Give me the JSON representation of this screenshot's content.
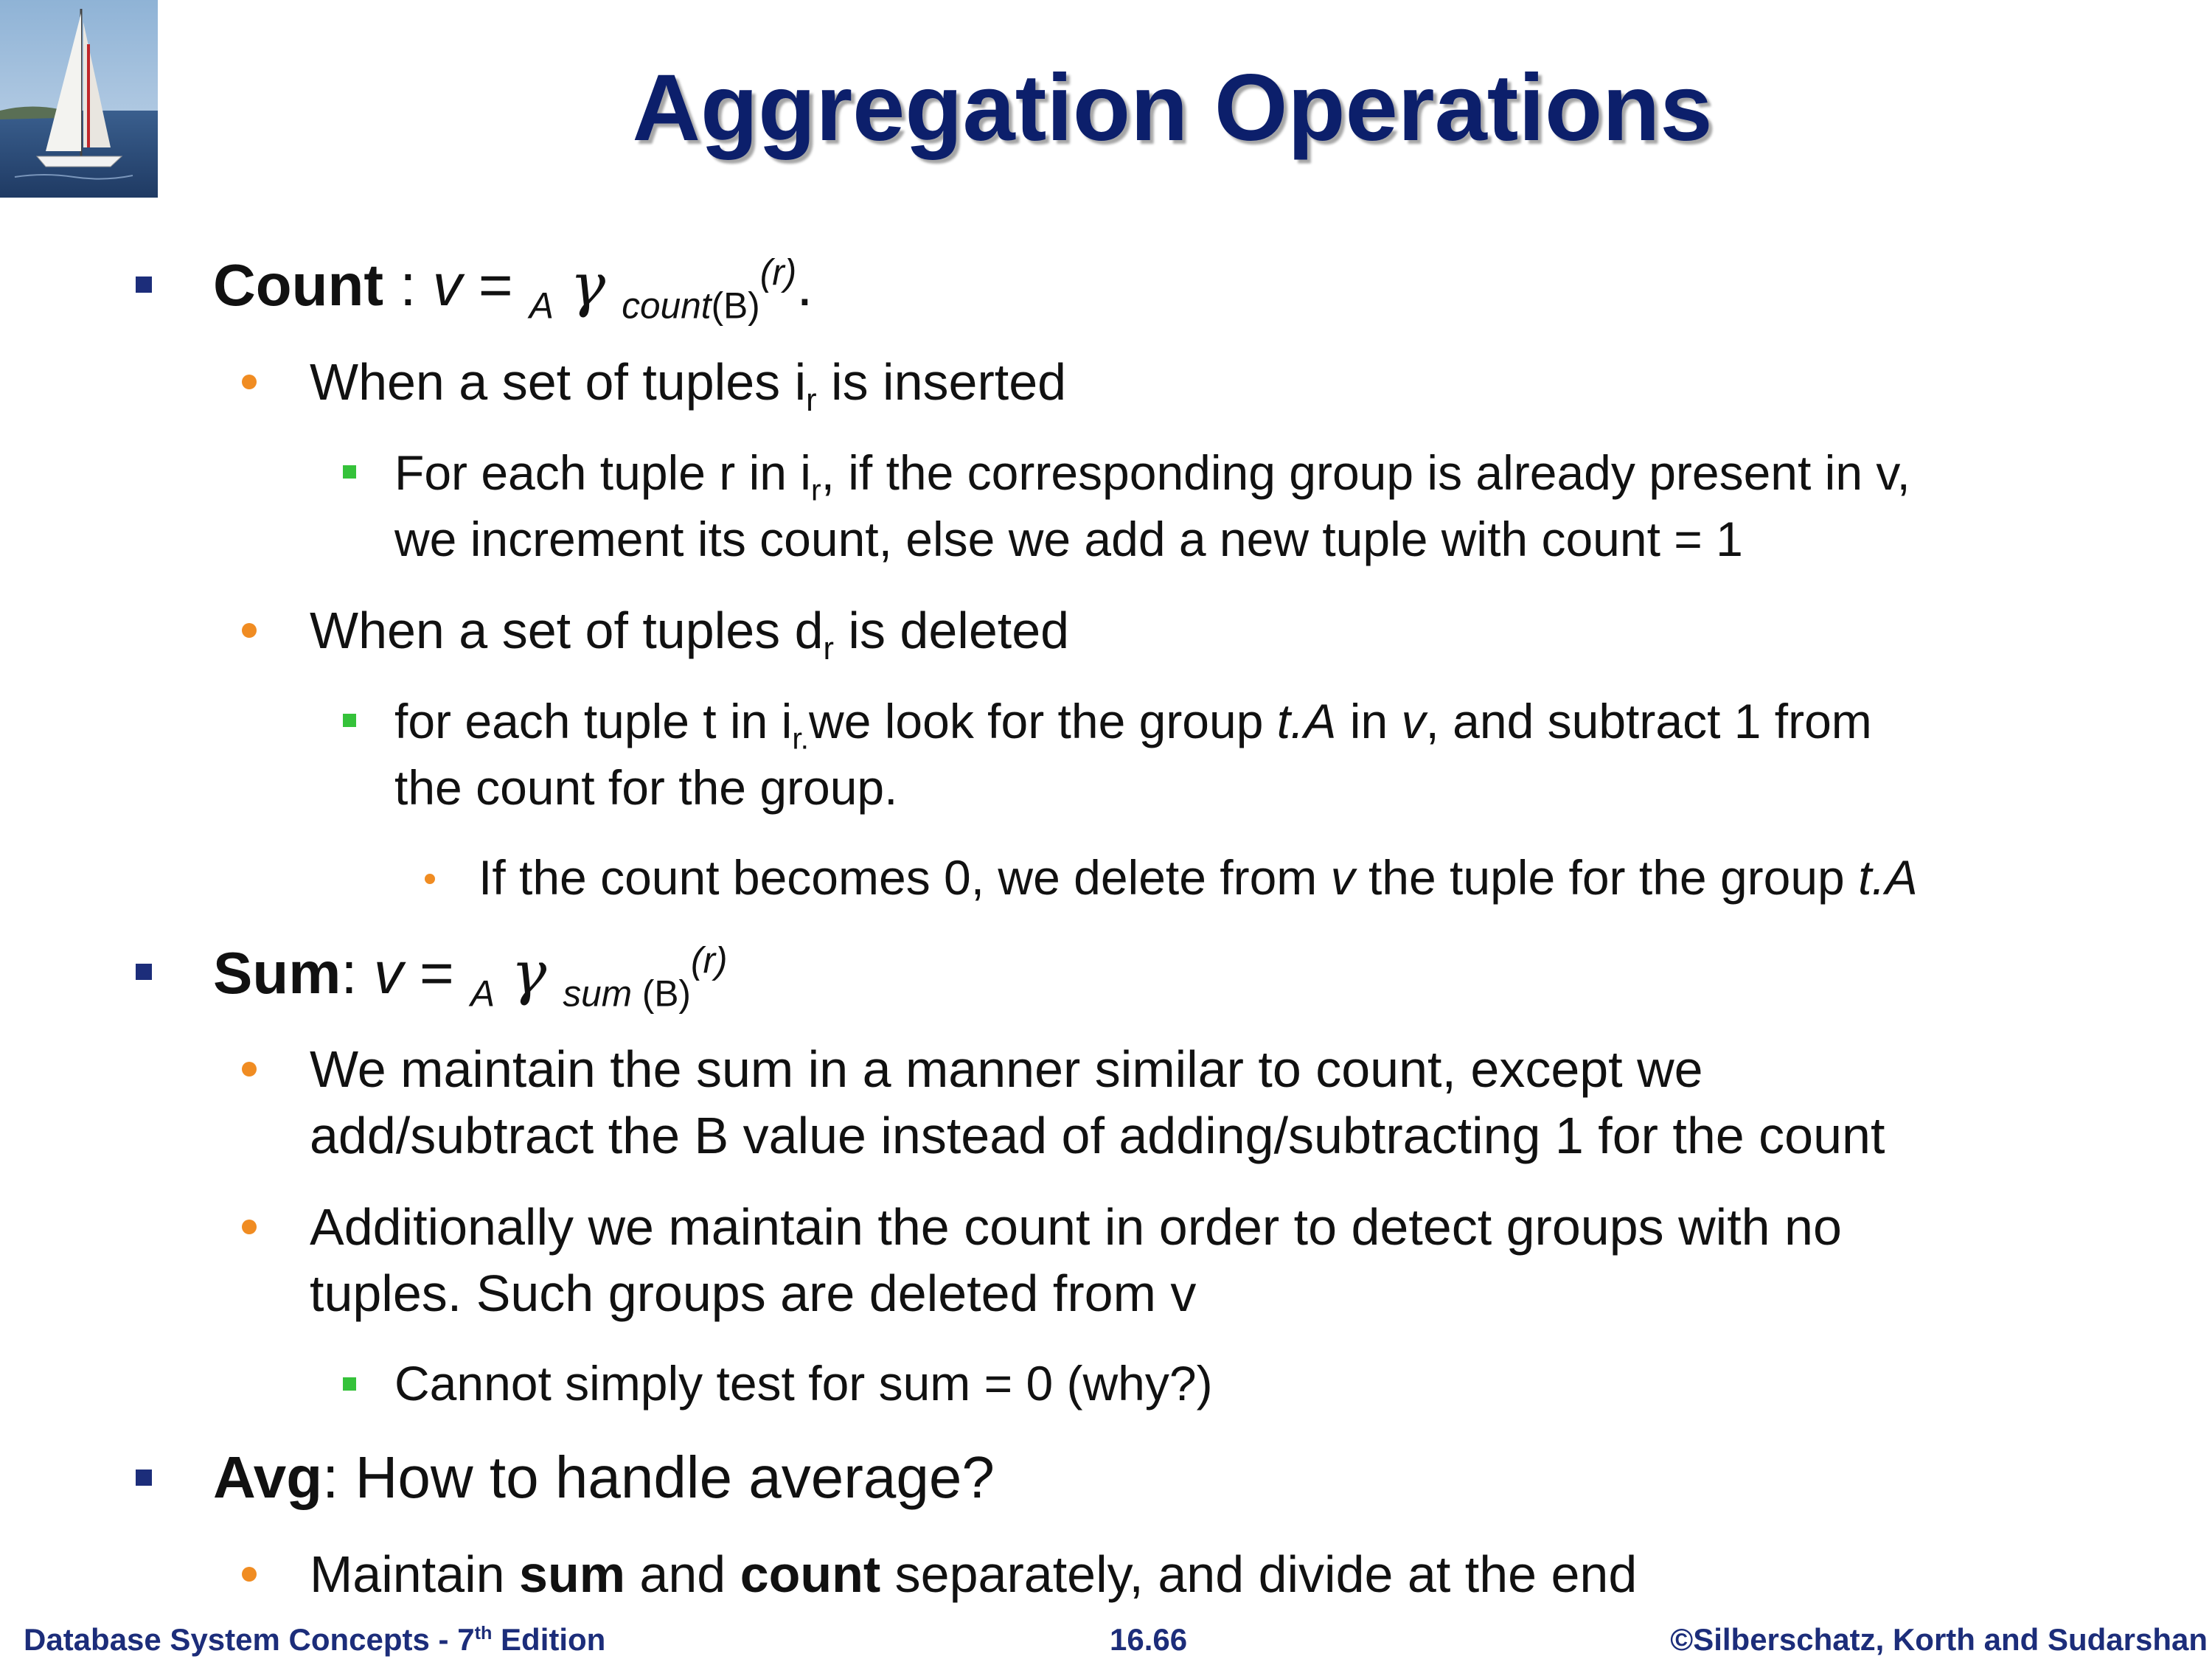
{
  "slide": {
    "title": "Aggregation Operations",
    "logo_description": "sailboat-image"
  },
  "count": {
    "label": "Count",
    "sep": " : ",
    "formula_v": "v",
    "formula_eq": " = ",
    "formula_group": "A",
    "formula_gamma": "γ",
    "formula_func": "count",
    "formula_arg": "(B)",
    "formula_rel": "(r)",
    "formula_end": ".",
    "insert": {
      "pre": "When a set of tuples i",
      "sub": "r",
      "post": " is inserted"
    },
    "insert_detail": {
      "l1_pre": "For each tuple r in i",
      "l1_sub": "r",
      "l1_post": ", if the corresponding group is already present in v,",
      "l2": "we increment its count, else we add a new tuple with count = 1"
    },
    "delete": {
      "pre": "When a set of tuples d",
      "sub": "r",
      "post": " is deleted"
    },
    "delete_detail": {
      "l1_pre": "for each tuple t in i",
      "l1_sub": "r.",
      "l1_mid": "we look for the group ",
      "l1_ta": "t.A",
      "l1_in": " in ",
      "l1_v": "v",
      "l1_post": ", and subtract 1 from",
      "l2": "the count for the group."
    },
    "zero": {
      "pre": "If the count becomes 0, we delete from ",
      "v": "v",
      "mid": " the tuple for the group ",
      "ta": "t.A"
    }
  },
  "sum": {
    "label": "Sum",
    "sep": ": ",
    "formula_v": "v",
    "formula_eq": " = ",
    "formula_group": "A",
    "formula_gamma": "γ",
    "formula_func": "sum",
    "formula_arg": " (B)",
    "formula_rel": "(r)",
    "p1_l1": "We maintain the sum in a manner similar to count, except we",
    "p1_l2": "add/subtract the B value instead of adding/subtracting 1 for the count",
    "p2_l1": "Additionally we maintain the count in order to detect groups with no",
    "p2_l2": "tuples.  Such groups are deleted from v",
    "p3": "Cannot simply test for sum = 0 (why?)"
  },
  "avg": {
    "label": "Avg",
    "text": ": How to handle average?",
    "m_pre": " Maintain ",
    "m_sum": "sum",
    "m_and": " and ",
    "m_count": "count",
    "m_post": " separately, and divide at the end"
  },
  "footer": {
    "left_pre": "Database System Concepts - 7",
    "left_sup": "th",
    "left_post": " Edition",
    "center": "16.66",
    "right": "©Silberschatz, Korth and Sudarshan"
  }
}
